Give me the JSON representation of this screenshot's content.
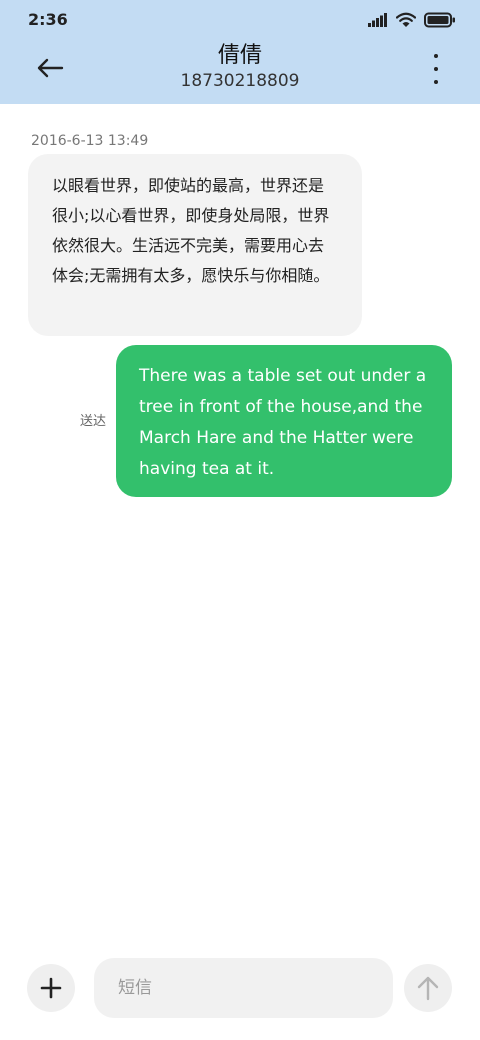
{
  "status_bar": {
    "time": "2:36",
    "icons": [
      "signal-icon",
      "wifi-icon",
      "battery-icon"
    ]
  },
  "header": {
    "back_icon": "back-arrow-icon",
    "contact_name": "倩倩",
    "contact_number": "18730218809",
    "more_icon": "more-vertical-icon"
  },
  "conversation": {
    "timestamp": "2016-6-13 13:49",
    "messages": [
      {
        "direction": "incoming",
        "text": "以眼看世界，即使站的最高，世界还是很小;以心看世界，即使身处局限，世界依然很大。生活远不完美，需要用心去体会;无需拥有太多，愿快乐与你相随。"
      },
      {
        "direction": "outgoing",
        "text": "There was a table set out under a tree in front of the house,and the March Hare and the Hatter were having tea at it.",
        "status": "送达"
      }
    ]
  },
  "composer": {
    "add_icon": "plus-icon",
    "placeholder": "短信",
    "value": "",
    "send_icon": "send-arrow-up-icon"
  },
  "colors": {
    "header_bg": "#c3dcf3",
    "incoming_bubble": "#f3f3f3",
    "outgoing_bubble": "#33c06c",
    "outgoing_text": "#ffffff"
  }
}
